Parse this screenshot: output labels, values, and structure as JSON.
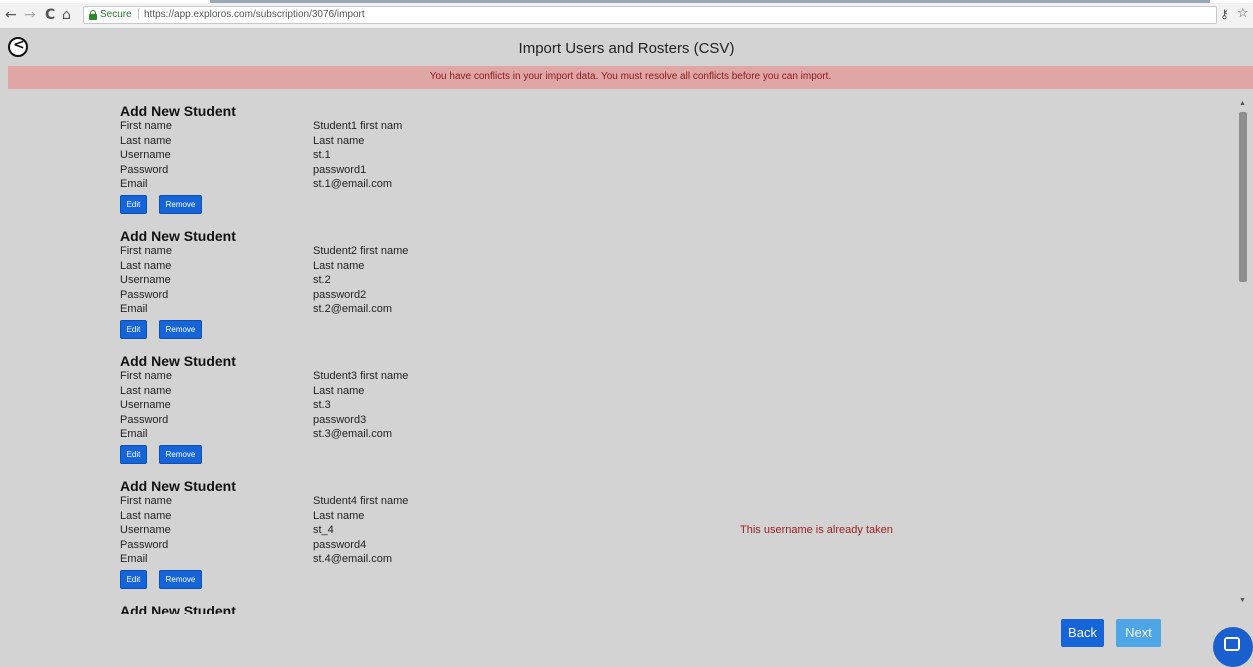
{
  "browser": {
    "back_glyph": "←",
    "forward_glyph": "→",
    "reload_glyph": "C",
    "home_glyph": "⌂",
    "secure_label": "Secure",
    "separator": "|",
    "url": "https://app.exploros.com/subscription/3076/import",
    "key_glyph": "⚷",
    "star_glyph": "☆"
  },
  "header": {
    "back_glyph": "<",
    "title": "Import Users and Rosters (CSV)"
  },
  "banner": {
    "message": "You have conflicts in your import data. You must resolve all conflicts before you can import."
  },
  "field_labels": {
    "first_name": "First name",
    "last_name": "Last name",
    "username": "Username",
    "password": "Password",
    "email": "Email"
  },
  "buttons": {
    "edit": "Edit",
    "remove": "Remove",
    "back": "Back",
    "next": "Next"
  },
  "students": [
    {
      "heading": "Add New Student",
      "first_name": "Student1 first nam",
      "last_name": "Last name",
      "username": "st.1",
      "password": "password1",
      "email": "st.1@email.com",
      "error": ""
    },
    {
      "heading": "Add New Student",
      "first_name": "Student2 first name",
      "last_name": "Last name",
      "username": "st.2",
      "password": "password2",
      "email": "st.2@email.com",
      "error": ""
    },
    {
      "heading": "Add New Student",
      "first_name": "Student3 first name",
      "last_name": "Last name",
      "username": "st.3",
      "password": "password3",
      "email": "st.3@email.com",
      "error": ""
    },
    {
      "heading": "Add New Student",
      "first_name": "Student4 first name",
      "last_name": "Last name",
      "username": "st_4",
      "password": "password4",
      "email": "st.4@email.com",
      "error": "This username is already taken"
    },
    {
      "heading": "Add New Student"
    }
  ],
  "colors": {
    "primary_button": "#1565d8",
    "disabled_button": "#4fa6e6",
    "banner_bg": "#e0a5a5",
    "error_text": "#9a2020",
    "page_bg": "#d3d3d3"
  },
  "icons": {
    "chat": "chat-icon",
    "lock": "lock-icon"
  }
}
